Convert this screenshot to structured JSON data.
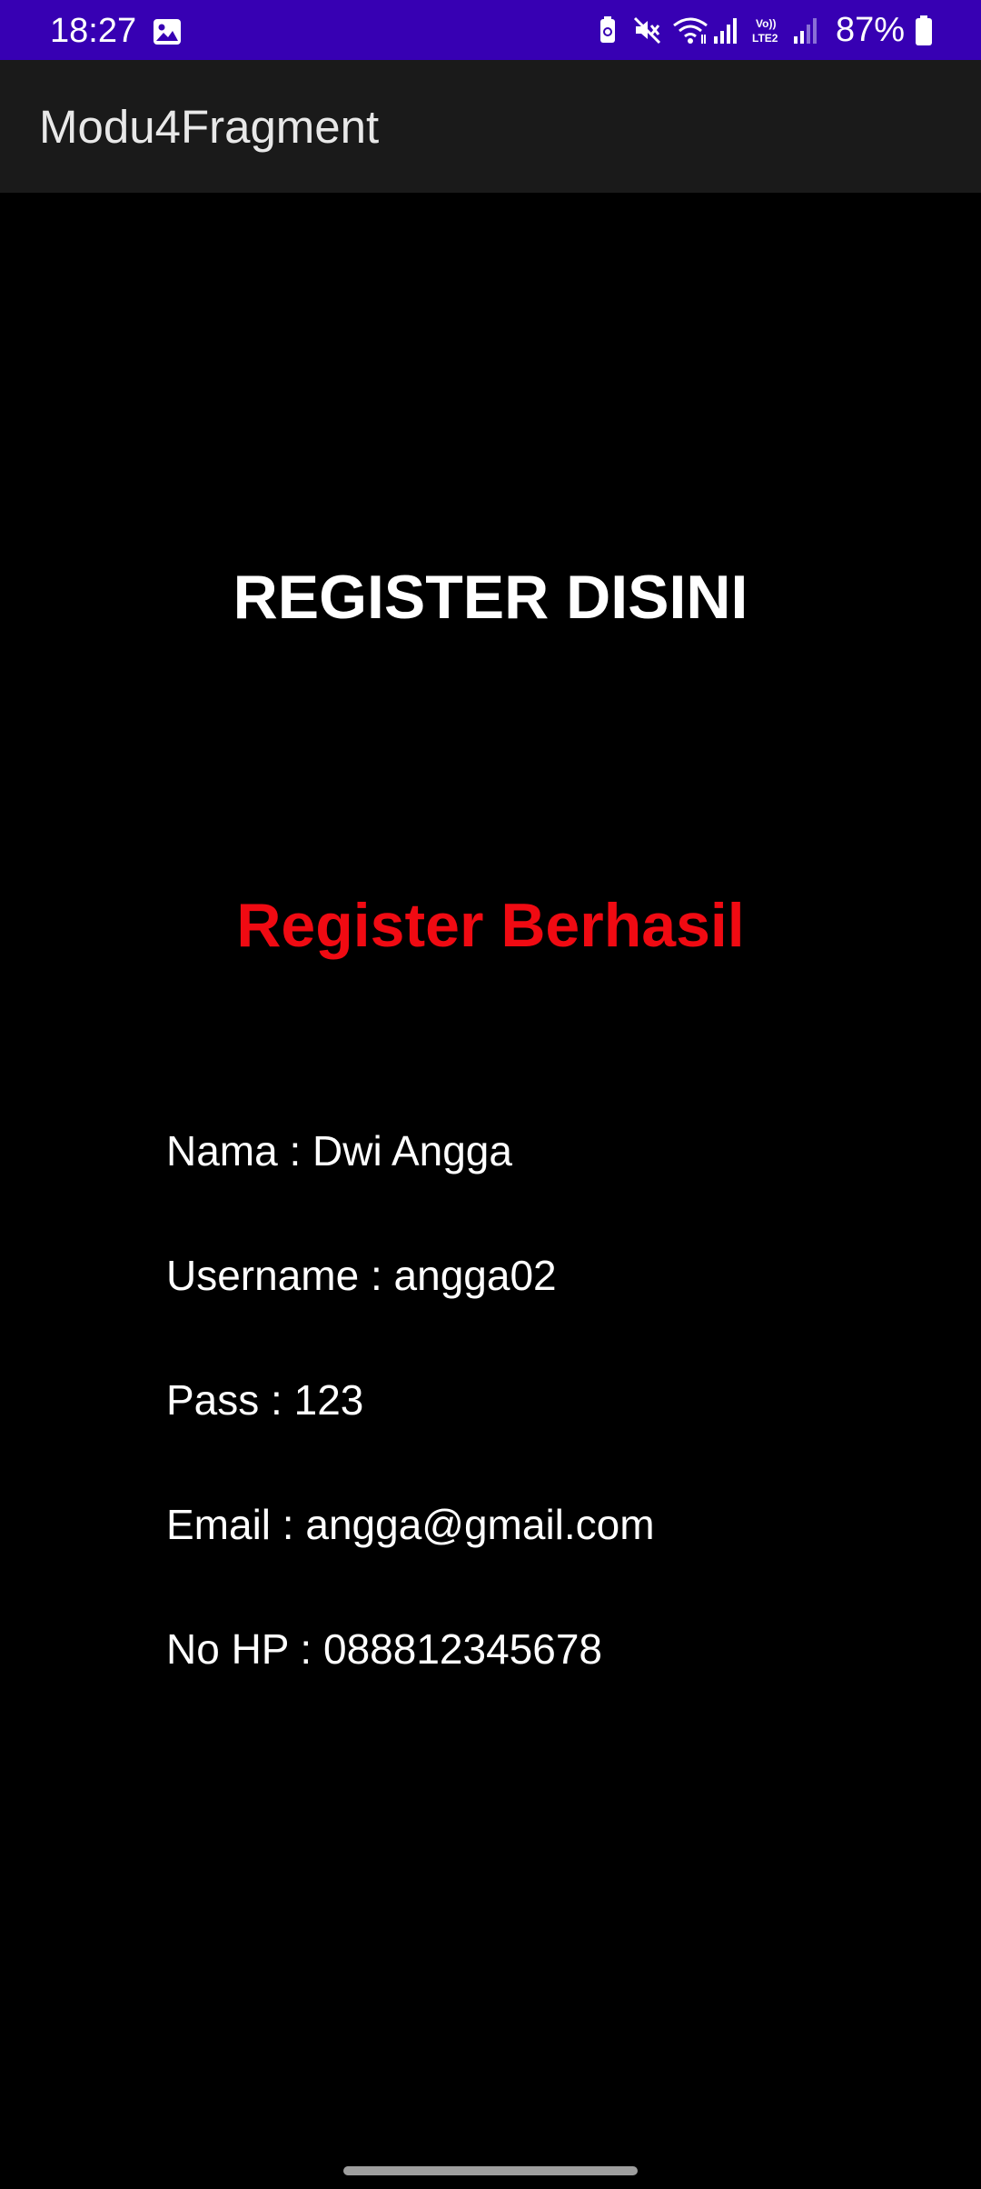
{
  "status_bar": {
    "time": "18:27",
    "battery_percent": "87%",
    "left_icons": [
      "gallery-icon"
    ],
    "right_icons": [
      "battery-saver-icon",
      "mute-icon",
      "wifi-icon",
      "signal-icon",
      "volte-lte2-icon",
      "signal-2-icon",
      "battery-icon"
    ],
    "background_color": "#3700b3"
  },
  "app_bar": {
    "title": "Modu4Fragment",
    "background_color": "#1a1a1a"
  },
  "content": {
    "heading": "REGISTER DISINI",
    "success_message": "Register Berhasil",
    "success_color": "#f00a12",
    "details": [
      {
        "text": "Nama : Dwi Angga"
      },
      {
        "text": "Username : angga02"
      },
      {
        "text": "Pass : 123"
      },
      {
        "text": "Email : angga@gmail.com"
      },
      {
        "text": "No HP : 088812345678"
      }
    ]
  }
}
